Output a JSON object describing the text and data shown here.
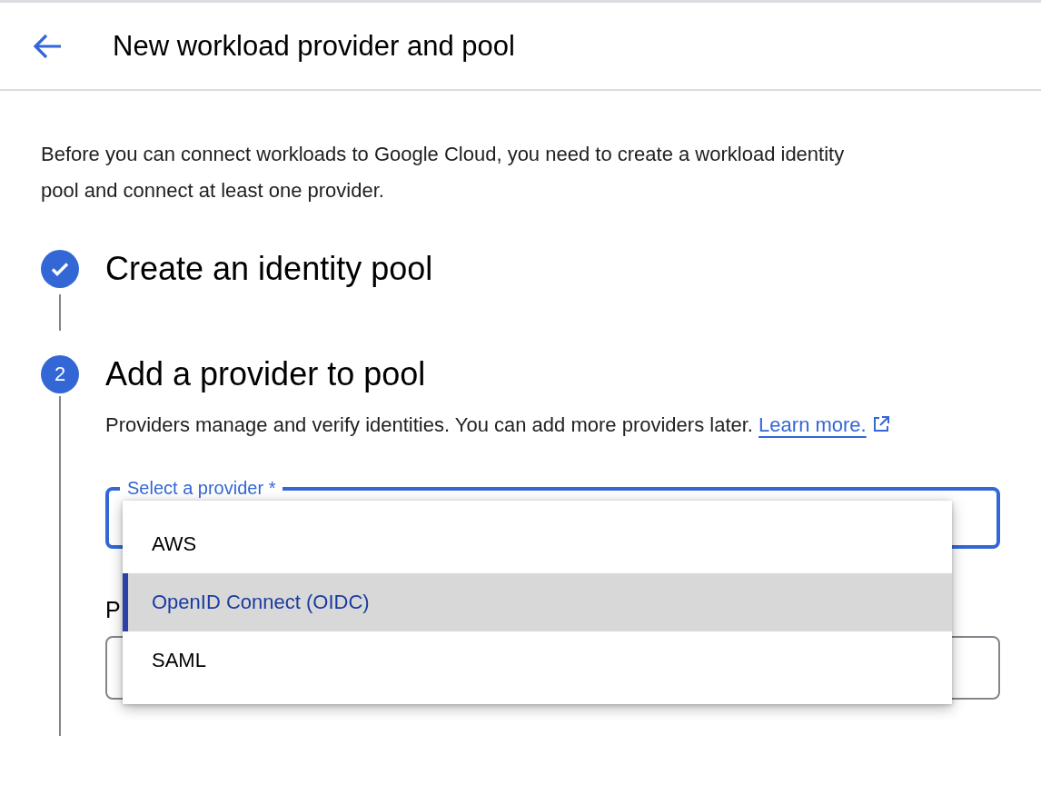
{
  "header": {
    "title": "New workload provider and pool"
  },
  "intro": "Before you can connect workloads to Google Cloud, you need to create a workload identity pool and connect at least one provider.",
  "steps": [
    {
      "title": "Create an identity pool",
      "done": true
    },
    {
      "number": "2",
      "title": "Add a provider to pool",
      "done": false
    }
  ],
  "provider_step": {
    "description": "Providers manage and verify identities. You can add more providers later.",
    "link": "Learn more.",
    "select": {
      "label": "Select a provider *",
      "focused": true,
      "options": [
        {
          "label": "AWS",
          "selected": false
        },
        {
          "label": "OpenID Connect (OIDC)",
          "selected": true
        },
        {
          "label": "SAML",
          "selected": false
        }
      ]
    },
    "section_heading": "P"
  }
}
